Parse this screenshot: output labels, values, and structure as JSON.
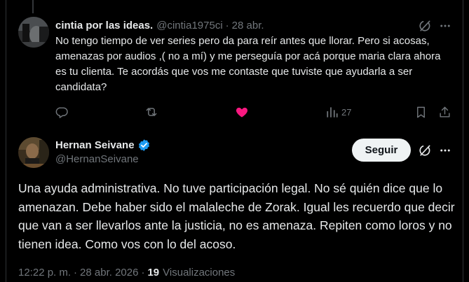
{
  "reply": {
    "display_name": "cintia por las ideas.",
    "handle": "@cintia1975ci",
    "separator": "·",
    "date": "28 abr.",
    "text": "No tengo tiempo de ver series pero da para reír antes que llorar. Pero si acosas, amenazas por audios ,( no a mí) y me perseguía por acá porque maria clara ahora es tu clienta. Te acordás que vos me contaste que tuviste que ayudarla a ser candidata?",
    "views_count": "27",
    "like_color": "#f91880",
    "icons": [
      "grok-icon",
      "more-icon",
      "reply-icon",
      "repost-icon",
      "heart-icon",
      "views-icon",
      "bookmark-icon",
      "share-icon"
    ]
  },
  "main": {
    "display_name": "Hernan Seivane",
    "verified": true,
    "verified_color": "#1d9bf0",
    "handle": "@HernanSeivane",
    "follow_label": "Seguir",
    "text": "Una ayuda administrativa. No tuve participación legal.  No sé quién dice que lo amenazan. Debe haber sido el malaleche de Zorak. Igual les recuerdo que decir que van a ser llevarlos ante la justicia, no es amenaza. Repiten como loros y no tienen idea. Como vos con lo del acoso.",
    "time": "12:22 p. m.",
    "separator": "·",
    "date": "28 abr. 2026",
    "views_count": "19",
    "views_label": "Visualizaciones",
    "icons": [
      "verified-badge-icon",
      "grok-icon",
      "more-icon"
    ]
  },
  "colors": {
    "background": "#000000",
    "text": "#e7e9ea",
    "muted": "#71767b",
    "border": "#2f3336"
  }
}
